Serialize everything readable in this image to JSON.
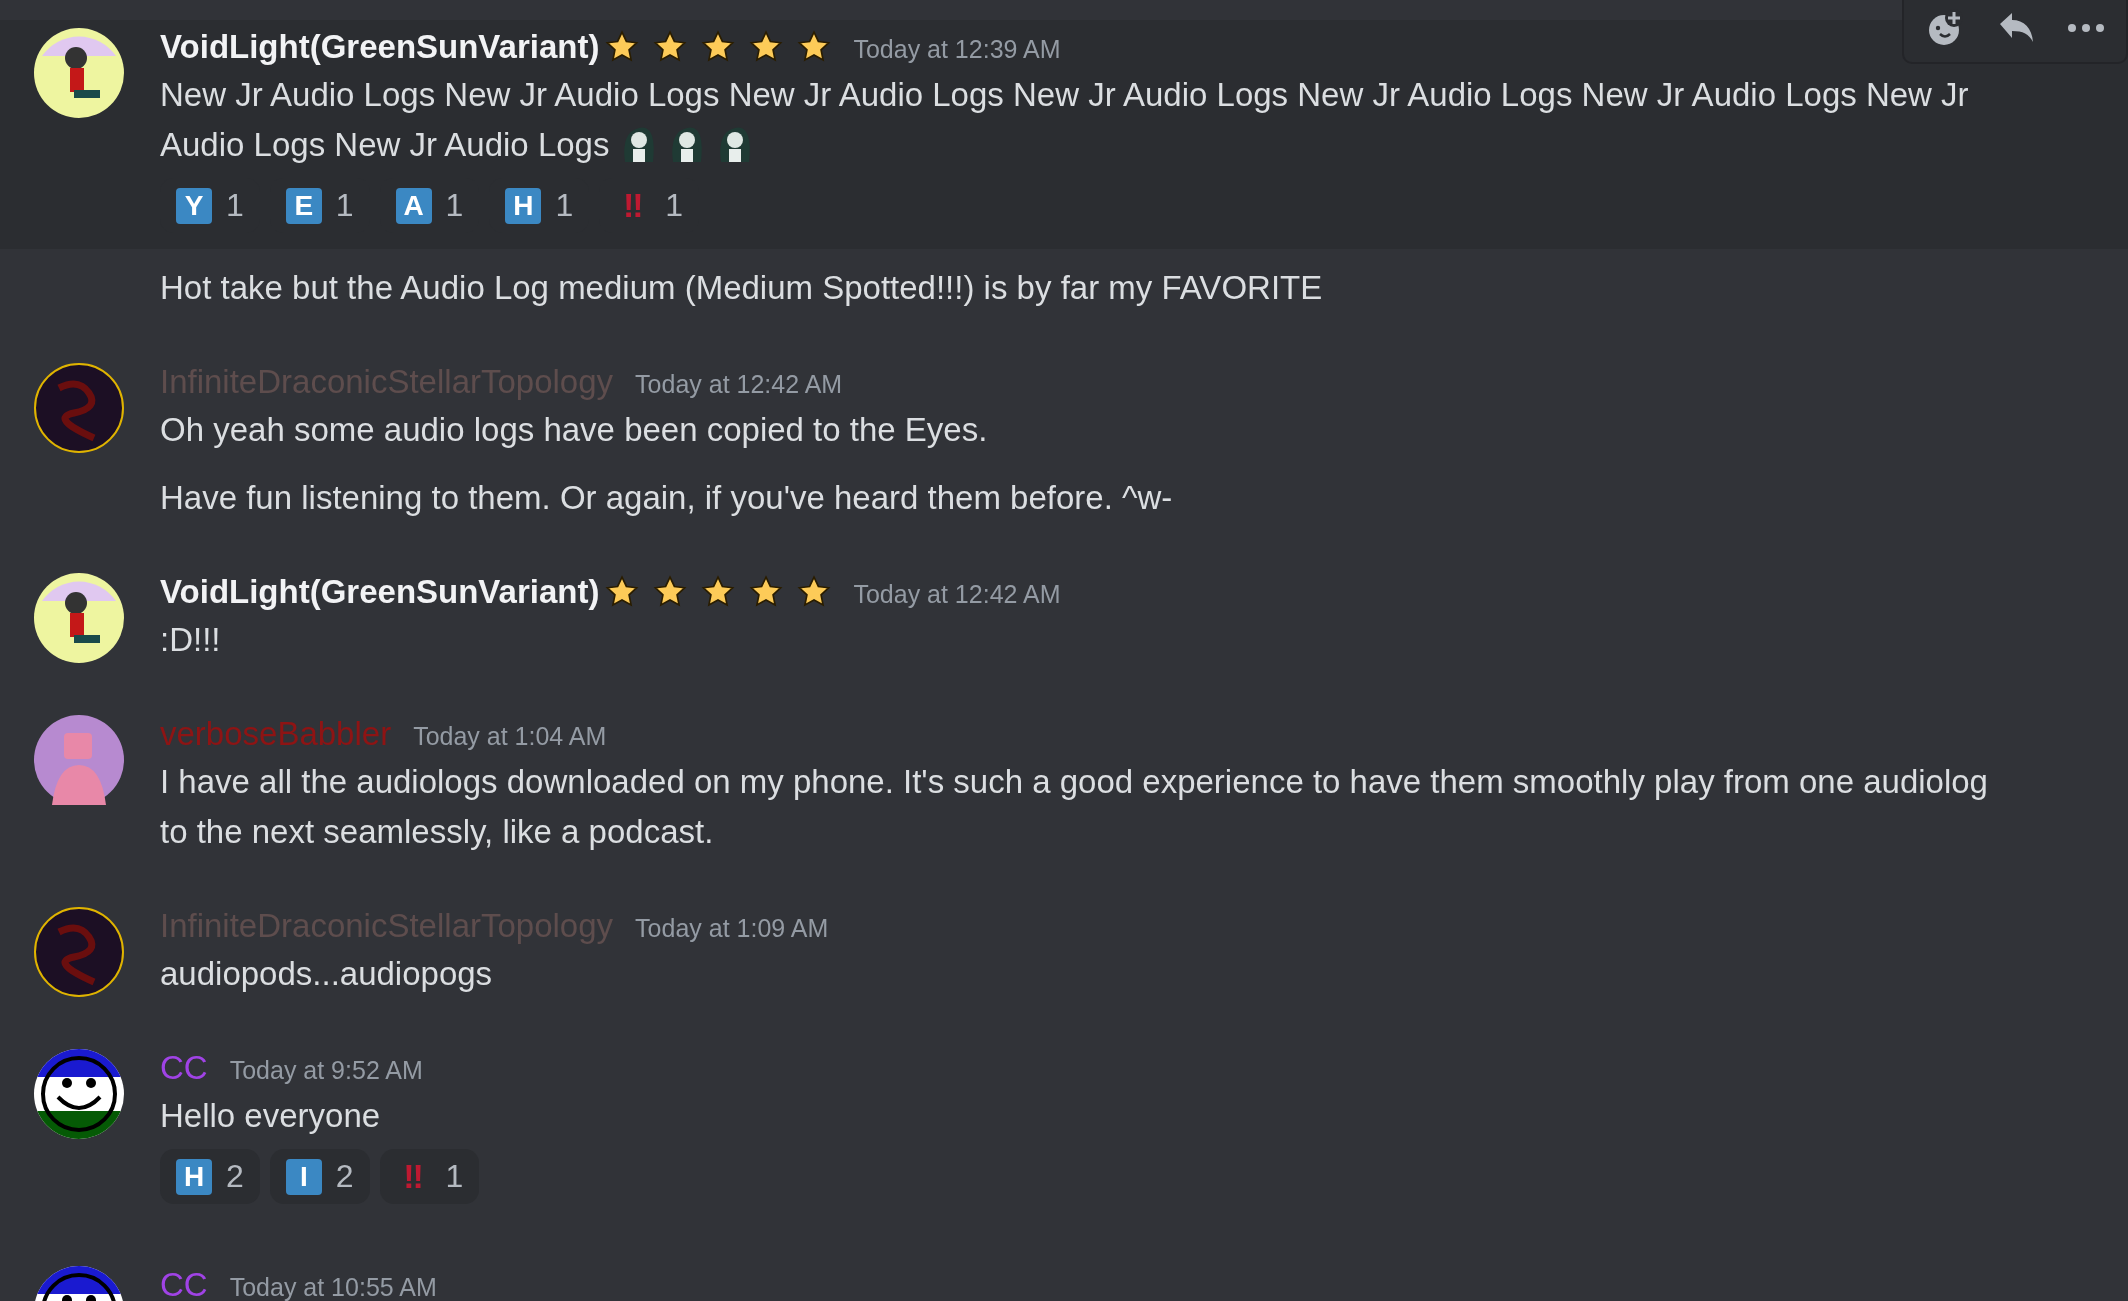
{
  "groups": [
    {
      "author": "VoidLight(GreenSunVariant)",
      "color": "#f2f3f5",
      "bold": true,
      "stars": 5,
      "time": "Today at 12:39 AM",
      "avatar": {
        "kind": "yellow-figure"
      },
      "messages": [
        {
          "hovered": true,
          "text": "New Jr Audio Logs New Jr Audio Logs New Jr Audio Logs New Jr Audio Logs New Jr Audio Logs New Jr Audio Logs New Jr Audio Logs New Jr Audio Logs",
          "emojis": [
            {
              "kind": "girl"
            },
            {
              "kind": "girl"
            },
            {
              "kind": "girl"
            }
          ],
          "reactions": [
            {
              "kind": "letter",
              "label": "Y",
              "count": "1"
            },
            {
              "kind": "letter",
              "label": "E",
              "count": "1"
            },
            {
              "kind": "letter",
              "label": "A",
              "count": "1"
            },
            {
              "kind": "letter",
              "label": "H",
              "count": "1"
            },
            {
              "kind": "bang",
              "label": "‼",
              "count": "1"
            }
          ]
        },
        {
          "text": "Hot take but the Audio Log medium (Medium Spotted!!!) is by far my FAVORITE"
        }
      ]
    },
    {
      "author": "InfiniteDraconicStellarTopology",
      "color": "#5e4d4d",
      "bold": false,
      "time": "Today at 12:42 AM",
      "avatar": {
        "kind": "dragon"
      },
      "messages": [
        {
          "text": "Oh yeah some audio logs have been copied to the Eyes."
        },
        {
          "text": "Have fun listening to them. Or again, if you've heard them before. ^w-"
        }
      ]
    },
    {
      "author": "VoidLight(GreenSunVariant)",
      "color": "#f2f3f5",
      "bold": true,
      "stars": 5,
      "time": "Today at 12:42 AM",
      "avatar": {
        "kind": "yellow-figure"
      },
      "messages": [
        {
          "text": ":D!!!"
        }
      ]
    },
    {
      "author": "verboseBabbler",
      "color": "#8e1414",
      "bold": false,
      "time": "Today at 1:04 AM",
      "avatar": {
        "kind": "purple-figure"
      },
      "messages": [
        {
          "text": "I have all the audiologs downloaded on my phone. It's such a good experience to have them smoothly play from one audiolog to the next seamlessly, like a podcast."
        }
      ]
    },
    {
      "author": "InfiniteDraconicStellarTopology",
      "color": "#5e4d4d",
      "bold": false,
      "time": "Today at 1:09 AM",
      "avatar": {
        "kind": "dragon"
      },
      "messages": [
        {
          "text": "audiopods...audiopogs"
        }
      ]
    },
    {
      "author": "CC",
      "color": "#a043e6",
      "bold": false,
      "time": "Today at 9:52 AM",
      "avatar": {
        "kind": "smiley"
      },
      "messages": [
        {
          "text": "Hello everyone",
          "reactions": [
            {
              "kind": "letter",
              "label": "H",
              "count": "2"
            },
            {
              "kind": "letter",
              "label": "I",
              "count": "2"
            },
            {
              "kind": "bang",
              "label": "‼",
              "count": "1"
            }
          ]
        }
      ]
    },
    {
      "author": "CC",
      "color": "#a043e6",
      "bold": false,
      "time": "Today at 10:55 AM",
      "avatar": {
        "kind": "smiley"
      }
    }
  ]
}
